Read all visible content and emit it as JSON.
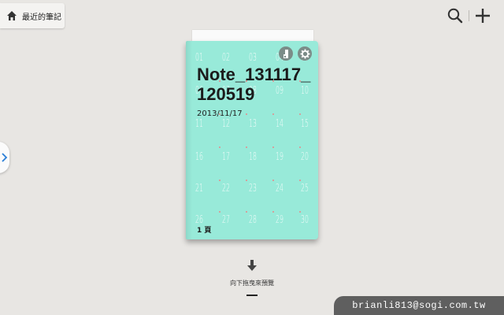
{
  "header": {
    "recent_label": "最近的筆記",
    "icons": {
      "home": "home-icon",
      "search": "search-icon",
      "add": "plus-icon"
    }
  },
  "sidebar": {
    "handle_icon": "chevron-right-icon",
    "accent": "#2a7ed6"
  },
  "notebook": {
    "title": "Note_131117_120519",
    "date": "2013/11/17",
    "pages": "1 頁",
    "cover_color": "#98ead9",
    "icons": {
      "lock": "lock-icon",
      "settings": "gear-icon"
    },
    "calendar": [
      "01",
      "02",
      "03",
      "04",
      "05",
      "06",
      "07",
      "08",
      "09",
      "10",
      "11",
      "12",
      "13",
      "14",
      "15",
      "16",
      "17",
      "18",
      "19",
      "20",
      "21",
      "22",
      "23",
      "24",
      "25",
      "26",
      "27",
      "28",
      "29",
      "30"
    ]
  },
  "drag_hint": {
    "text": "向下拖曳來預覽",
    "icon": "arrow-down-icon"
  },
  "account": {
    "email": "brianli813@sogi.com.tw"
  }
}
